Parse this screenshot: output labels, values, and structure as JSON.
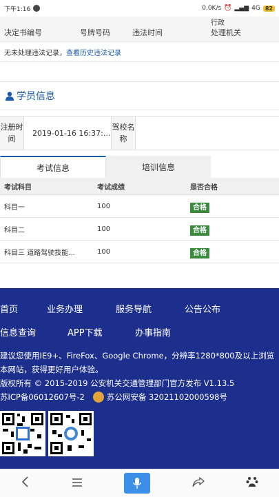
{
  "status_bar": {
    "time": "下午1:16",
    "net_speed": "0.0K/s",
    "network": "4G",
    "battery": "82"
  },
  "violations": {
    "headers": [
      "决定书编号",
      "号牌号码",
      "违法时间",
      "处理机关"
    ],
    "small_label": "行政",
    "empty_text": "无未处理违法记录，",
    "history_link": "查看历史违法记录"
  },
  "student": {
    "title": "学员信息",
    "reg_time_label": "注册时间",
    "reg_time_value": "2019-01-16 16:37:...",
    "school_label": "驾校名称",
    "school_value": ""
  },
  "tabs": [
    {
      "label": "考试信息"
    },
    {
      "label": "培训信息"
    }
  ],
  "exam": {
    "headers": [
      "考试科目",
      "考试成绩",
      "是否合格"
    ],
    "rows": [
      {
        "subject": "科目一",
        "score": "100",
        "result": "合格"
      },
      {
        "subject": "科目二",
        "score": "100",
        "result": "合格"
      },
      {
        "subject": "科目三 道路驾驶技能...",
        "score": "100",
        "result": "合格"
      }
    ]
  },
  "footer": {
    "nav_row1": [
      "首页",
      "业务办理",
      "服务导航",
      "公告公布"
    ],
    "nav_row2": [
      "信息查询",
      "APP下载",
      "办事指南"
    ],
    "browser_note": "建议您使用IE9+、FireFox、Google Chrome，分辨率1280*800及以上浏览本网站，获得更好用户体验。",
    "copyright": "版权所有 © 2015-2019 公安机关交通管理部门官方发布 V1.13.5",
    "icp": "苏ICP备06012607号-2",
    "police_record": "苏公网安备 32021102000598号"
  },
  "colors": {
    "brand": "#1a5aa8",
    "footer_bg": "#1d2f8c",
    "pass_badge": "#3b8a3e"
  }
}
